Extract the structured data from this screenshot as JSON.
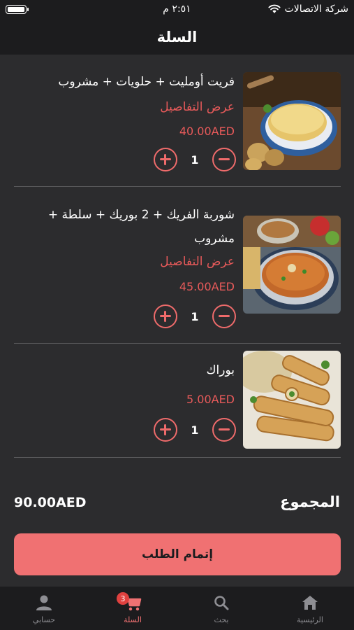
{
  "status_bar": {
    "time": "٢:٥١ م",
    "carrier": "شركة الاتصالات"
  },
  "header": {
    "title": "السلة"
  },
  "items": [
    {
      "name": "فريت أومليت + حلويات + مشروب",
      "details_label": "عرض التفاصيل",
      "price": "40.00AED",
      "quantity": "1"
    },
    {
      "name": "شوربة الفريك + 2 بوريك + سلطة + مشروب",
      "details_label": "عرض التفاصيل",
      "price": "45.00AED",
      "quantity": "1"
    },
    {
      "name": "بوراك",
      "price": "5.00AED",
      "quantity": "1"
    }
  ],
  "summary": {
    "total_label": "المجموع",
    "total_value": "90.00AED"
  },
  "checkout": {
    "label": "إتمام الطلب"
  },
  "tabs": [
    {
      "label": "الرئيسية",
      "icon": "home-icon"
    },
    {
      "label": "بحث",
      "icon": "search-icon"
    },
    {
      "label": "السلة",
      "icon": "cart-icon",
      "badge": "3",
      "active": true
    },
    {
      "label": "حسابي",
      "icon": "person-icon"
    }
  ],
  "colors": {
    "accent": "#f07172",
    "price": "#e85a5a",
    "background": "#2c2c2e",
    "bar": "#1c1c1e"
  }
}
